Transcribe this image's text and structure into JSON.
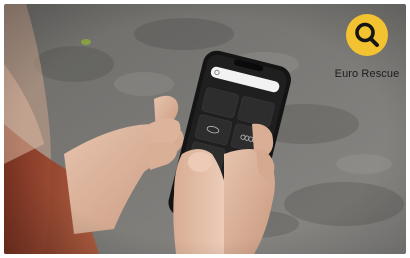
{
  "brand": {
    "name": "Euro Rescue",
    "logo_icon": "magnifier-icon",
    "accent_color": "#f2c230"
  },
  "photo": {
    "subject_icon": "smartphone-in-hands"
  }
}
